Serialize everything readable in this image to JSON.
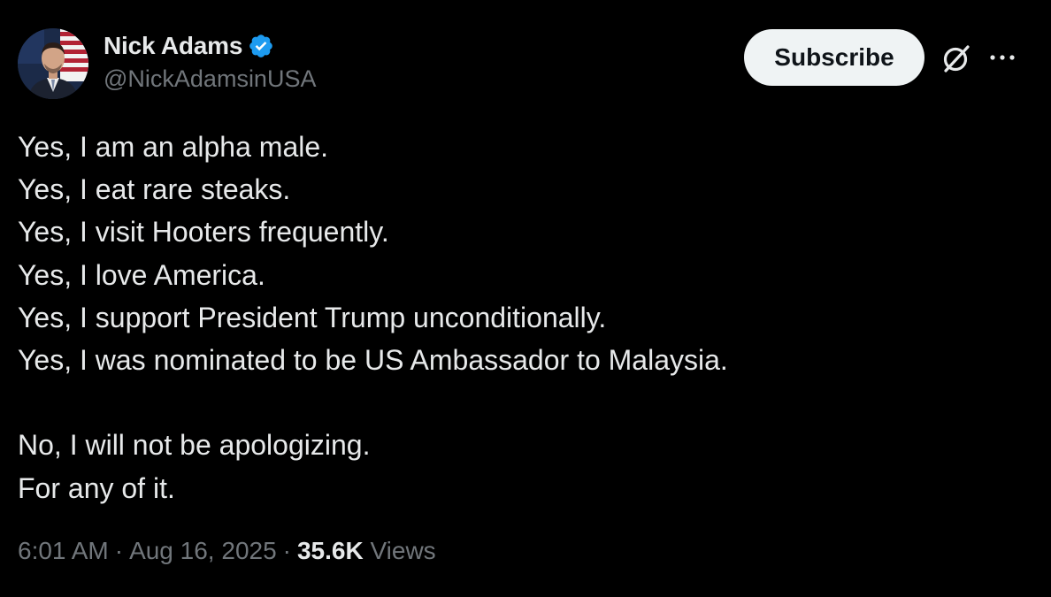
{
  "author": {
    "display_name": "Nick Adams",
    "handle": "@NickAdamsinUSA",
    "verified": true,
    "verified_color": "#1d9bf0"
  },
  "actions": {
    "subscribe_label": "Subscribe",
    "grok_icon": "grok-icon",
    "more_icon": "more-icon"
  },
  "tweet": {
    "lines": [
      "Yes, I am an alpha male.",
      "Yes, I eat rare steaks.",
      "Yes, I visit Hooters frequently.",
      "Yes, I love America.",
      "Yes, I support President Trump unconditionally.",
      "Yes, I was nominated to be US Ambassador to Malaysia.",
      "",
      "No, I will not be apologizing.",
      "For any of it."
    ]
  },
  "meta": {
    "time": "6:01 AM",
    "separator": "·",
    "date": "Aug 16, 2025",
    "views_count": "35.6K",
    "views_label": "Views"
  },
  "colors": {
    "background": "#000000",
    "text_primary": "#e7e9ea",
    "text_secondary": "#71767b",
    "button_bg": "#eff3f4"
  }
}
